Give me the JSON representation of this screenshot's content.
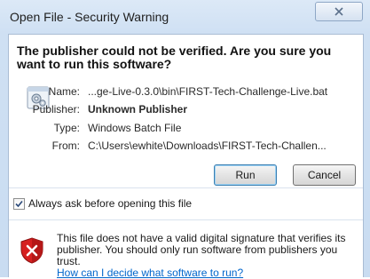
{
  "window": {
    "title": "Open File - Security Warning"
  },
  "headline": "The publisher could not be verified.  Are you sure you want to run this software?",
  "details": [
    {
      "label": "Name:",
      "value": "...ge-Live-0.3.0\\bin\\FIRST-Tech-Challenge-Live.bat",
      "bold": false
    },
    {
      "label": "Publisher:",
      "value": "Unknown Publisher",
      "bold": true
    },
    {
      "label": "Type:",
      "value": "Windows Batch File",
      "bold": false
    },
    {
      "label": "From:",
      "value": "C:\\Users\\ewhite\\Downloads\\FIRST-Tech-Challen...",
      "bold": false
    }
  ],
  "buttons": {
    "run": "Run",
    "cancel": "Cancel"
  },
  "checkbox": {
    "label": "Always ask before opening this file",
    "checked": true
  },
  "warning": {
    "text": "This file does not have a valid digital signature that verifies its publisher.  You should only run software from publishers you trust.",
    "link": "How can I decide what software to run?"
  },
  "icons": {
    "file": "batch-file-gear-icon",
    "warning": "security-shield-x-icon",
    "close": "close-icon"
  },
  "colors": {
    "frame": "#cfe0f3",
    "link": "#0066cc",
    "shield_red": "#d62020"
  }
}
